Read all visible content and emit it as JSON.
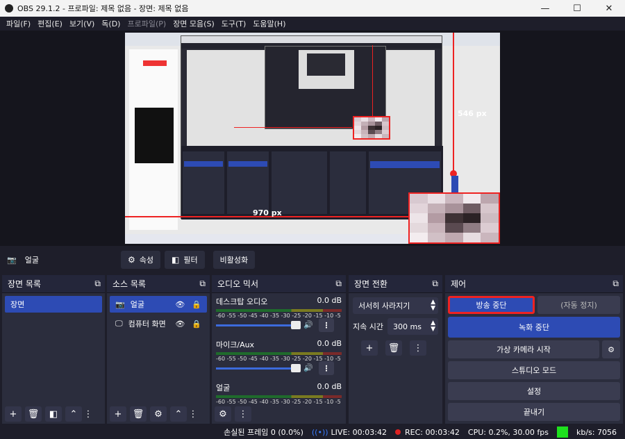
{
  "window": {
    "title": "OBS 29.1.2 - 프로파일: 제목 없음 - 장면: 제목 없음",
    "min": "—",
    "max": "☐",
    "close": "✕"
  },
  "menu": [
    "파일(F)",
    "편집(E)",
    "보기(V)",
    "독(D)",
    "프로파일(P)",
    "장면 모음(S)",
    "도구(T)",
    "도움말(H)"
  ],
  "preview": {
    "width_label": "970 px",
    "height_label": "546 px"
  },
  "source_toolbar": {
    "source_name": "얼굴",
    "properties": "속성",
    "filters": "필터",
    "deactivate": "비활성화"
  },
  "scenes": {
    "title": "장면 목록",
    "items": [
      "장면"
    ]
  },
  "sources": {
    "title": "소스 목록",
    "items": [
      {
        "name": "얼굴",
        "selected": true
      },
      {
        "name": "컴퓨터 화면",
        "selected": false
      }
    ]
  },
  "mixer": {
    "title": "오디오 믹서",
    "ticks": "-60 -55 -50 -45 -40 -35 -30 -25 -20 -15 -10 -5 0",
    "channels": [
      {
        "name": "데스크탑 오디오",
        "level": "0.0 dB"
      },
      {
        "name": "마이크/Aux",
        "level": "0.0 dB"
      },
      {
        "name": "얼굴",
        "level": "0.0 dB"
      }
    ]
  },
  "transitions": {
    "title": "장면 전환",
    "type": "서서히 사라지기",
    "duration_label": "지속 시간",
    "duration": "300 ms"
  },
  "controls": {
    "title": "제어",
    "stop_stream": "방송 중단",
    "auto_stop": "(자동 정지)",
    "stop_recording": "녹화 중단",
    "virtual_camera": "가상 카메라 시작",
    "studio_mode": "스튜디오 모드",
    "settings": "설정",
    "exit": "끝내기"
  },
  "status": {
    "dropped": "손실된 프레임 0 (0.0%)",
    "live": "LIVE: 00:03:42",
    "rec": "REC: 00:03:42",
    "cpu": "CPU: 0.2%, 30.00 fps",
    "kbps": "kb/s: 7056"
  },
  "colors": {
    "accent": "#2d4bb4",
    "highlight": "#e22222",
    "ok": "#1ee01e"
  }
}
